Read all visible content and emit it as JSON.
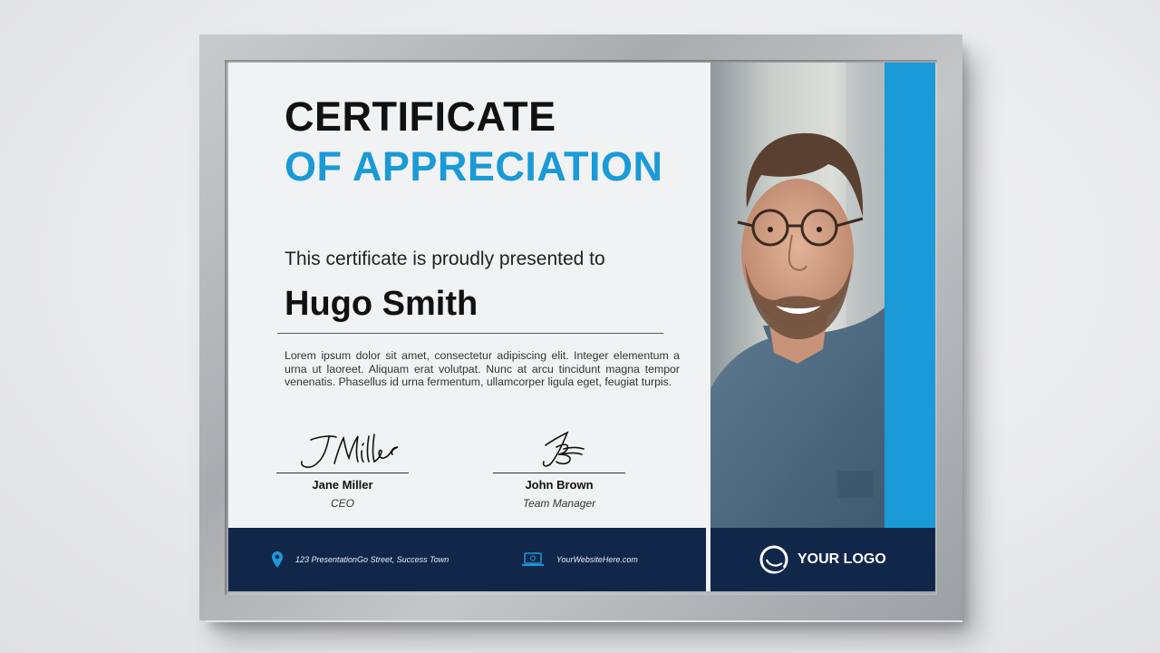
{
  "certificate": {
    "title_line1": "CERTIFICATE",
    "title_line2": "OF APPRECIATION",
    "presented_text": "This certificate is proudly presented to",
    "recipient_name": "Hugo Smith",
    "body": "Lorem ipsum dolor sit amet, consectetur adipiscing elit. Integer elementum a urna ut laoreet. Aliquam erat volutpat. Nunc at arcu tincidunt magna tempor venenatis. Phasellus id urna fermentum, ullamcorper ligula eget, feugiat turpis."
  },
  "signatures": [
    {
      "script": "JMiller",
      "name": "Jane Miller",
      "role": "CEO"
    },
    {
      "script": "JB",
      "name": "John Brown",
      "role": "Team Manager"
    }
  ],
  "footer": {
    "address": "123 PresentationGo Street, Success Town",
    "website": "YourWebsiteHere.com",
    "logo_text": "YOUR LOGO",
    "icons": [
      "location-pin-icon",
      "laptop-icon",
      "logo-ring-icon"
    ]
  },
  "colors": {
    "accent": "#1a9ad6",
    "navy": "#11274a",
    "paper": "#f1f2f3",
    "frame": "#b0b2b5"
  }
}
